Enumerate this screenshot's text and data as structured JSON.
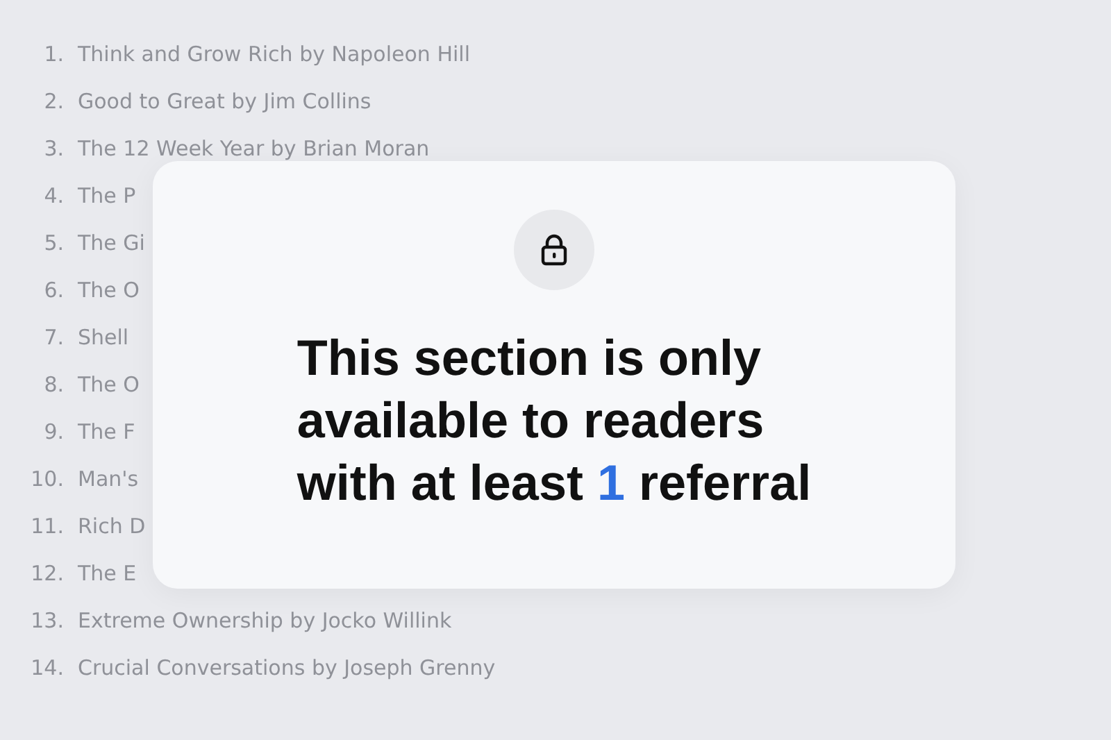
{
  "list": [
    {
      "number": "1.",
      "text": "Think and Grow Rich by Napoleon Hill"
    },
    {
      "number": "2.",
      "text": "Good to Great by Jim Collins"
    },
    {
      "number": "3.",
      "text": "The 12 Week Year by Brian Moran"
    },
    {
      "number": "4.",
      "text": "The P"
    },
    {
      "number": "5.",
      "text": "The Gi"
    },
    {
      "number": "6.",
      "text": "The O"
    },
    {
      "number": "7.",
      "text": "Shell"
    },
    {
      "number": "8.",
      "text": "The O"
    },
    {
      "number": "9.",
      "text": "The F"
    },
    {
      "number": "10.",
      "text": "Man's"
    },
    {
      "number": "11.",
      "text": "Rich D"
    },
    {
      "number": "12.",
      "text": "The E"
    },
    {
      "number": "13.",
      "text": "Extreme Ownership by Jocko Willink"
    },
    {
      "number": "14.",
      "text": "Crucial Conversations by Joseph Grenny"
    }
  ],
  "lock_card": {
    "message_lines": [
      "This section is only",
      "available to readers"
    ],
    "last_line": {
      "before": "with at least ",
      "highlight": "1",
      "after": " referral"
    }
  }
}
